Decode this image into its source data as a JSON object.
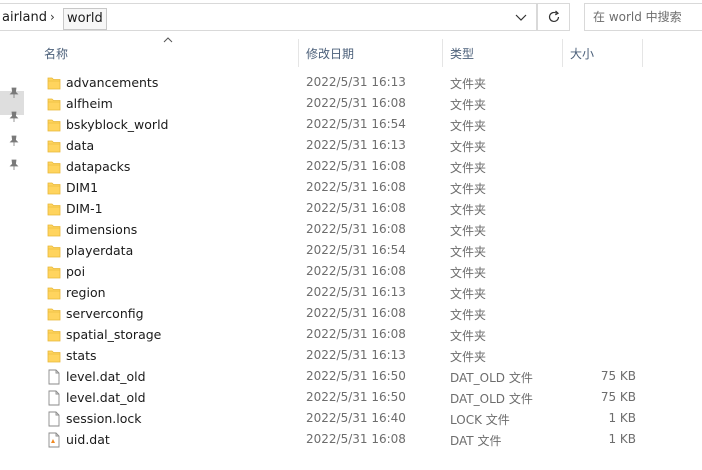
{
  "address_bar": {
    "crumbs": [
      "airland",
      "world"
    ],
    "separator": "›"
  },
  "search": {
    "placeholder": "在 world 中搜索"
  },
  "columns": {
    "name": "名称",
    "date": "修改日期",
    "type": "类型",
    "size": "大小"
  },
  "files": [
    {
      "name": "advancements",
      "date": "2022/5/31 16:13",
      "type": "文件夹",
      "size": "",
      "kind": "folder"
    },
    {
      "name": "alfheim",
      "date": "2022/5/31 16:08",
      "type": "文件夹",
      "size": "",
      "kind": "folder"
    },
    {
      "name": "bskyblock_world",
      "date": "2022/5/31 16:54",
      "type": "文件夹",
      "size": "",
      "kind": "folder"
    },
    {
      "name": "data",
      "date": "2022/5/31 16:13",
      "type": "文件夹",
      "size": "",
      "kind": "folder"
    },
    {
      "name": "datapacks",
      "date": "2022/5/31 16:08",
      "type": "文件夹",
      "size": "",
      "kind": "folder"
    },
    {
      "name": "DIM1",
      "date": "2022/5/31 16:08",
      "type": "文件夹",
      "size": "",
      "kind": "folder"
    },
    {
      "name": "DIM-1",
      "date": "2022/5/31 16:08",
      "type": "文件夹",
      "size": "",
      "kind": "folder"
    },
    {
      "name": "dimensions",
      "date": "2022/5/31 16:08",
      "type": "文件夹",
      "size": "",
      "kind": "folder"
    },
    {
      "name": "playerdata",
      "date": "2022/5/31 16:54",
      "type": "文件夹",
      "size": "",
      "kind": "folder"
    },
    {
      "name": "poi",
      "date": "2022/5/31 16:08",
      "type": "文件夹",
      "size": "",
      "kind": "folder"
    },
    {
      "name": "region",
      "date": "2022/5/31 16:13",
      "type": "文件夹",
      "size": "",
      "kind": "folder"
    },
    {
      "name": "serverconfig",
      "date": "2022/5/31 16:08",
      "type": "文件夹",
      "size": "",
      "kind": "folder"
    },
    {
      "name": "spatial_storage",
      "date": "2022/5/31 16:08",
      "type": "文件夹",
      "size": "",
      "kind": "folder"
    },
    {
      "name": "stats",
      "date": "2022/5/31 16:13",
      "type": "文件夹",
      "size": "",
      "kind": "folder"
    },
    {
      "name": "level.dat_old",
      "date": "2022/5/31 16:50",
      "type": "DAT_OLD 文件",
      "size": "75 KB",
      "kind": "file"
    },
    {
      "name": "level.dat_old",
      "date": "2022/5/31 16:50",
      "type": "DAT_OLD 文件",
      "size": "75 KB",
      "kind": "file"
    },
    {
      "name": "session.lock",
      "date": "2022/5/31 16:40",
      "type": "LOCK 文件",
      "size": "1 KB",
      "kind": "file"
    },
    {
      "name": "uid.dat",
      "date": "2022/5/31 16:08",
      "type": "DAT 文件",
      "size": "1 KB",
      "kind": "vlc-file"
    }
  ],
  "colors": {
    "folder": "#FFD45E",
    "folder_dark": "#E8B83A",
    "header_text": "#4C607A"
  },
  "icons": {
    "dropdown": "chevron-down-icon",
    "refresh": "refresh-icon",
    "pin": "pin-icon",
    "folder": "folder-icon",
    "file": "file-icon",
    "sort": "sort-up-icon"
  }
}
